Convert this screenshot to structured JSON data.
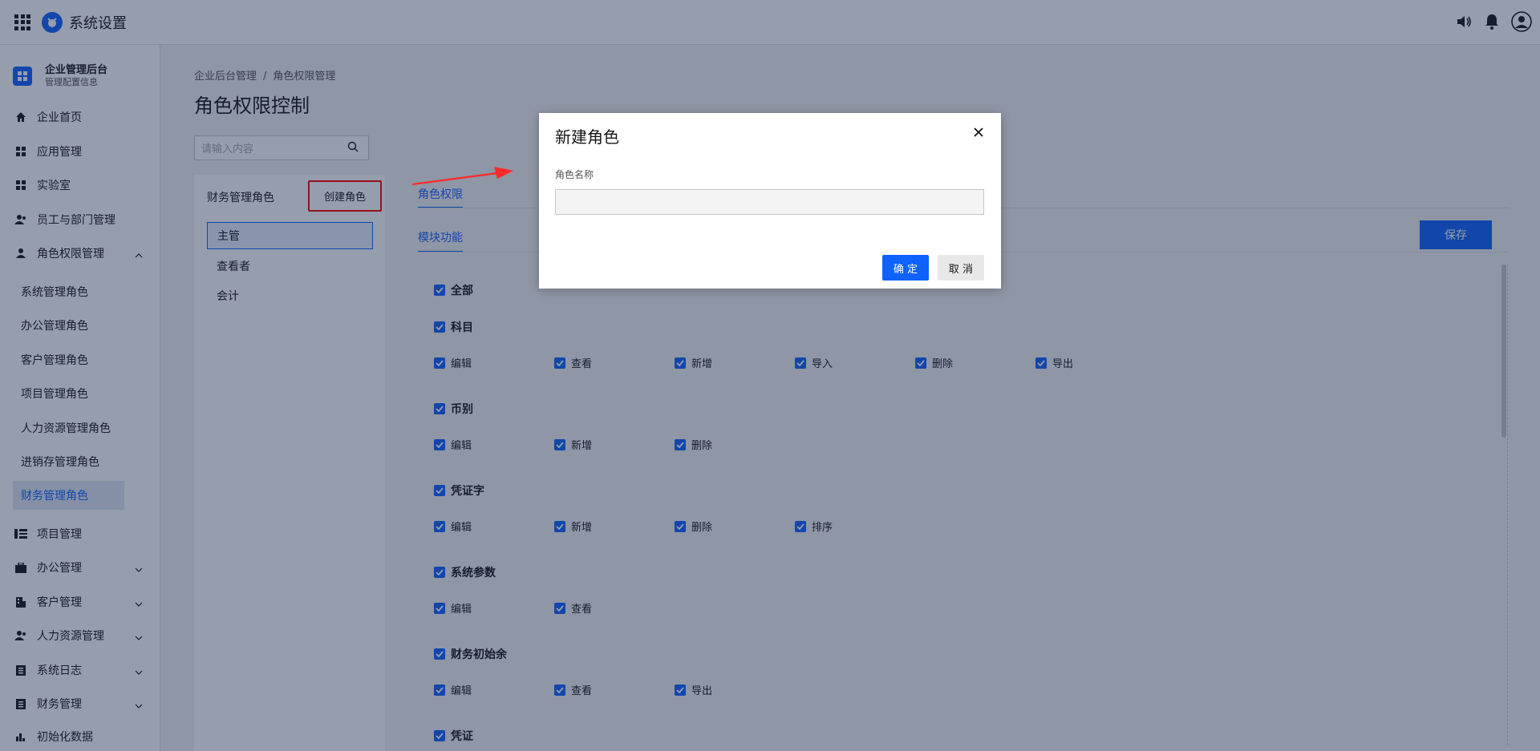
{
  "header": {
    "title": "系统设置"
  },
  "org": {
    "name": "企业管理后台",
    "sub": "管理配置信息"
  },
  "nav": [
    {
      "label": "企业首页",
      "icon": "home-icon"
    },
    {
      "label": "应用管理",
      "icon": "grid-icon"
    },
    {
      "label": "实验室",
      "icon": "grid-icon"
    },
    {
      "label": "员工与部门管理",
      "icon": "users-icon"
    },
    {
      "label": "角色权限管理",
      "icon": "user-icon",
      "expanded": true
    }
  ],
  "subnav": [
    "系统管理角色",
    "办公管理角色",
    "客户管理角色",
    "项目管理角色",
    "人力资源管理角色",
    "进销存管理角色",
    "财务管理角色"
  ],
  "nav2": [
    {
      "label": "项目管理",
      "icon": "list-icon"
    },
    {
      "label": "办公管理",
      "icon": "briefcase-icon"
    },
    {
      "label": "客户管理",
      "icon": "building-icon"
    },
    {
      "label": "人力资源管理",
      "icon": "users-icon"
    },
    {
      "label": "系统日志",
      "icon": "log-icon"
    },
    {
      "label": "财务管理",
      "icon": "log-icon"
    },
    {
      "label": "初始化数据",
      "icon": "chart-icon"
    }
  ],
  "breadcrumb": {
    "a": "企业后台管理",
    "sep": "/",
    "b": "角色权限管理"
  },
  "page": {
    "title": "角色权限控制"
  },
  "search": {
    "placeholder": "请输入内容"
  },
  "roles": {
    "title": "财务管理角色",
    "create": "创建角色",
    "items": [
      "主管",
      "查看者",
      "会计"
    ]
  },
  "tabs": {
    "perm": "角色权限",
    "module": "模块功能",
    "save": "保存"
  },
  "perms": [
    {
      "group": "全部",
      "items": []
    },
    {
      "group": "科目",
      "items": [
        "编辑",
        "查看",
        "新增",
        "导入",
        "删除",
        "导出"
      ]
    },
    {
      "group": "币别",
      "items": [
        "编辑",
        "新增",
        "删除"
      ]
    },
    {
      "group": "凭证字",
      "items": [
        "编辑",
        "新增",
        "删除",
        "排序"
      ]
    },
    {
      "group": "系统参数",
      "items": [
        "编辑",
        "查看"
      ]
    },
    {
      "group": "财务初始余",
      "items": [
        "编辑",
        "查看",
        "导出"
      ]
    },
    {
      "group": "凭证",
      "items": []
    }
  ],
  "modal": {
    "title": "新建角色",
    "field_label": "角色名称",
    "field_value": "",
    "ok": "确 定",
    "cancel": "取 消"
  }
}
